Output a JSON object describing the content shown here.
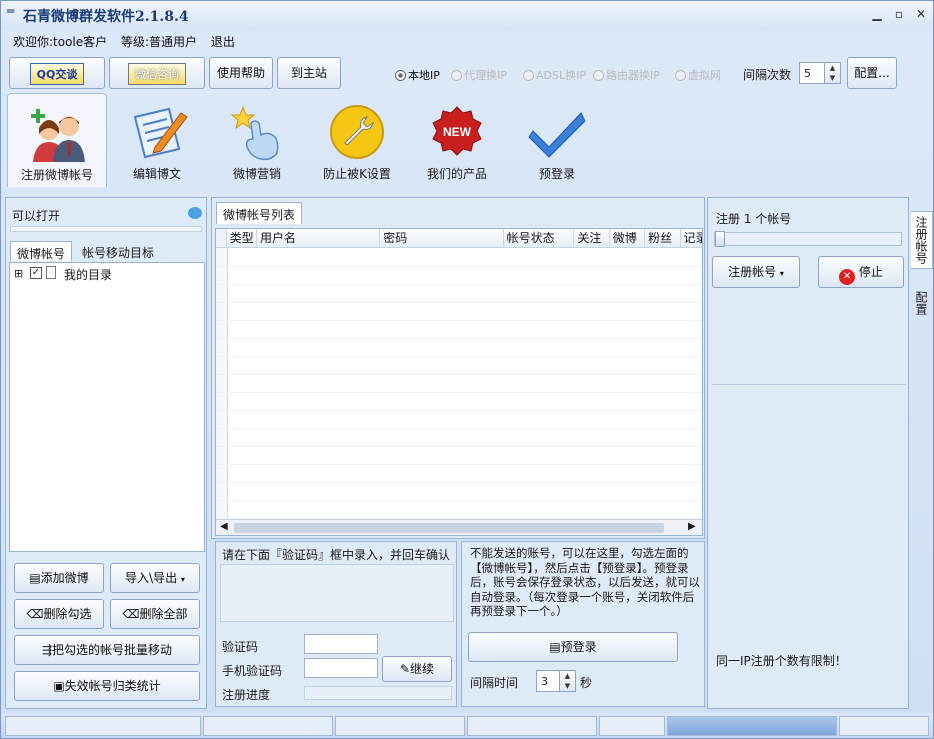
{
  "app": {
    "title": "石青微博群发软件2.1.8.4"
  },
  "userbar": {
    "welcome": "欢迎你:",
    "username": "toole客户",
    "level_label": "等级:",
    "level": "普通用户",
    "logout": "退出"
  },
  "toolbar": {
    "qq": "QQ交谈",
    "wechat": "微信咨询",
    "help": "使用帮助",
    "home": "到主站",
    "ip_options": [
      "本地IP",
      "代理换IP",
      "ADSL换IP",
      "路由器换IP",
      "虚拟网"
    ],
    "interval_label": "间隔次数",
    "interval_value": "5",
    "config": "配置..."
  },
  "tabs": [
    "注册微博帐号",
    "编辑博文",
    "微博营销",
    "防止被K设置",
    "我们的产品",
    "预登录"
  ],
  "new_badge": "NEW",
  "left": {
    "openable": "可以打开",
    "tabs": [
      "微博帐号",
      "帐号移动目标"
    ],
    "tree_root": "我的目录",
    "tree_expander": "⊞",
    "buttons": {
      "add": "添加微博",
      "import_export": "导入\\导出",
      "delete_checked": "删除勾选",
      "delete_all": "删除全部",
      "batch_move": "把勾选的帐号批量移动",
      "invalid_stats": "失效帐号归类统计"
    }
  },
  "center": {
    "tab": "微博帐号列表",
    "columns": [
      "类型",
      "用户名",
      "密码",
      "帐号状态",
      "关注",
      "微博",
      "粉丝",
      "记录"
    ],
    "hint": "请在下面『验证码』框中录入，并回车确认",
    "captcha": "验证码",
    "phone_code": "手机验证码",
    "continue": "继续",
    "progress": "注册进度",
    "notice": "不能发送的账号，可以在这里，勾选左面的【微博帐号】，然后点击【预登录】。预登录后，账号会保存登录状态，以后发送，就可以自动登录。（每次登录一个账号，关闭软件后再预登录下一个。）",
    "prelogin": "预登录",
    "interval_time": "间隔时间",
    "interval_time_value": "3",
    "seconds": "秒"
  },
  "right": {
    "register_count": "注册 1 个帐号",
    "register": "注册帐号",
    "stop": "停止",
    "limit": "同一IP注册个数有限制！",
    "side_tabs": [
      "注册帐号",
      "配置"
    ]
  }
}
